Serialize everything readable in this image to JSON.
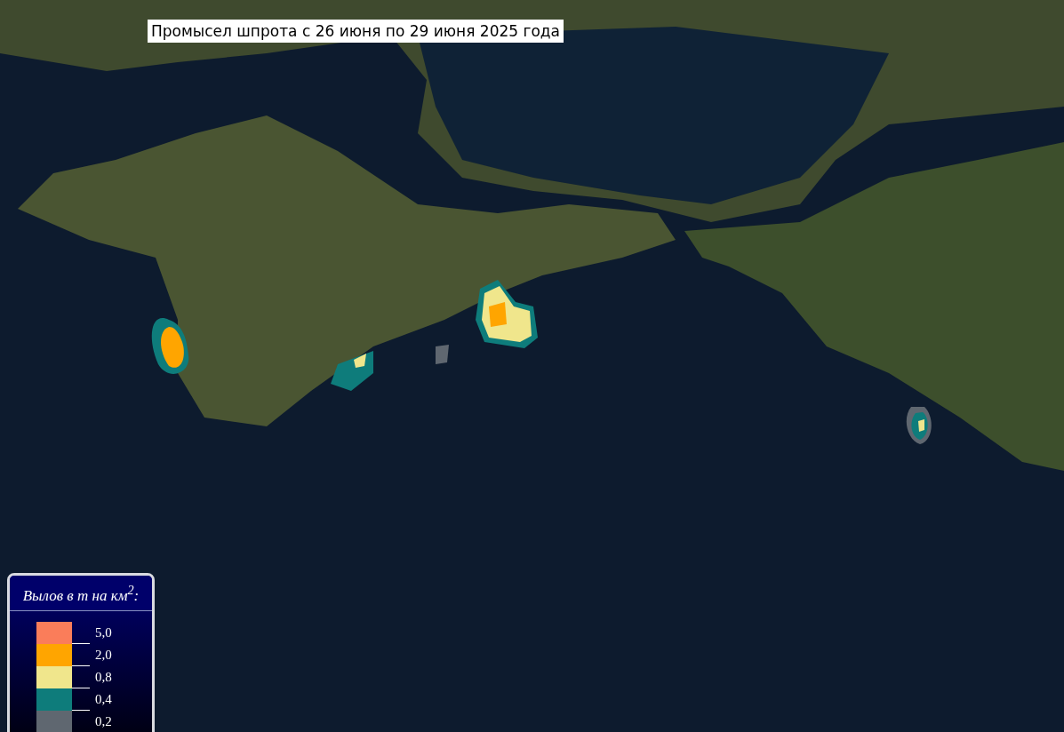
{
  "title": "Промысел шпрота с 26 июня по 29 июня 2025 года",
  "legend": {
    "title": "Вылов в т на км$^{2}$:",
    "items": [
      {
        "label": "5,0",
        "color": "#fa7d5a"
      },
      {
        "label": "2,0",
        "color": "#ffa500"
      },
      {
        "label": "0,8",
        "color": "#f0e68c"
      },
      {
        "label": "0,4",
        "color": "#0e7c7b"
      },
      {
        "label": "0,2",
        "color": "#5f6770"
      }
    ]
  }
}
